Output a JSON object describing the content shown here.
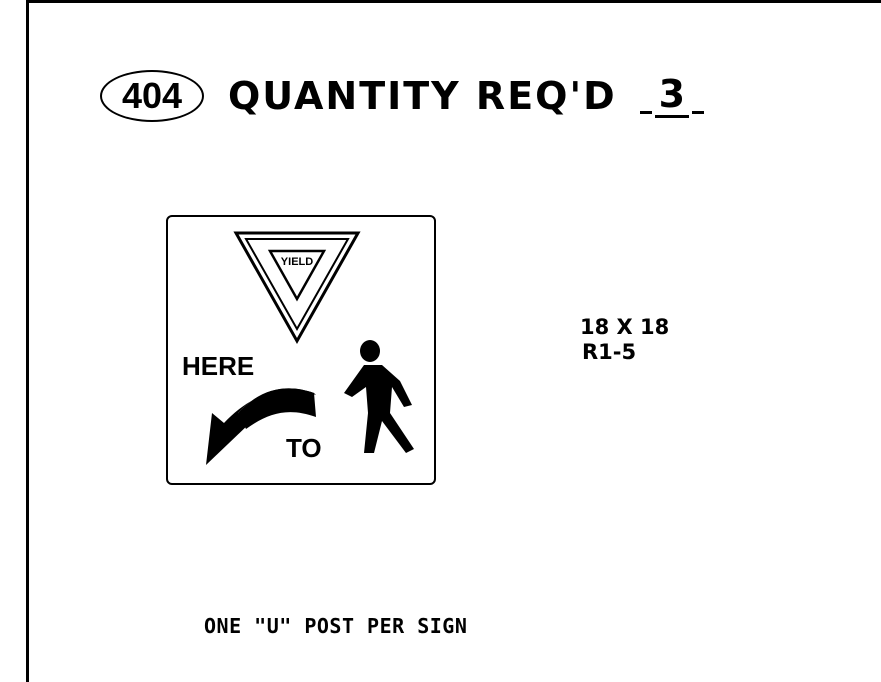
{
  "header": {
    "item_number": "404",
    "quantity_label": "QUANTITY REQ'D",
    "quantity_value": "3"
  },
  "sign": {
    "yield_text": "YIELD",
    "here_text": "HERE",
    "to_text": "TO",
    "icons": [
      "yield-triangle-icon",
      "curved-arrow-icon",
      "pedestrian-icon"
    ]
  },
  "spec": {
    "size": "18 X 18",
    "code": "R1-5"
  },
  "note": "ONE \"U\" POST PER SIGN"
}
